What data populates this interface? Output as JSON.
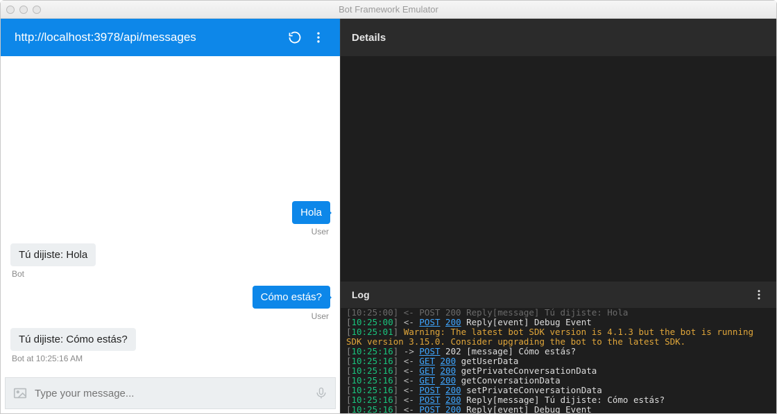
{
  "window": {
    "title": "Bot Framework Emulator"
  },
  "toolbar": {
    "url": "http://localhost:3978/api/messages"
  },
  "chat": {
    "messages": [
      {
        "side": "user",
        "text": "Hola",
        "sender": "User"
      },
      {
        "side": "bot",
        "text": "Tú dijiste: Hola",
        "sender": "Bot"
      },
      {
        "side": "user",
        "text": "Cómo estás?",
        "sender": "User"
      },
      {
        "side": "bot",
        "text": "Tú dijiste: Cómo estás?",
        "sender": "Bot at 10:25:16 AM"
      }
    ],
    "composer_placeholder": "Type your message..."
  },
  "panels": {
    "details": "Details",
    "log": "Log"
  },
  "log": [
    {
      "ts": "10:25:00",
      "dir": "<-",
      "method": "POST",
      "status": "200",
      "rest": "Reply[message] Tú dijiste: Hola",
      "clipped": true
    },
    {
      "ts": "10:25:00",
      "dir": "<-",
      "method": "POST",
      "status": "200",
      "rest": "Reply[event] Debug Event"
    },
    {
      "ts": "10:25:01",
      "warn": "Warning: The latest bot SDK version is 4.1.3 but the bot is running SDK version 3.15.0. Consider upgrading the bot to the latest SDK."
    },
    {
      "ts": "10:25:16",
      "dir": "->",
      "method": "POST",
      "status_plain": "202",
      "rest": "[message] Cómo estás?"
    },
    {
      "ts": "10:25:16",
      "dir": "<-",
      "method": "GET",
      "status": "200",
      "rest": "getUserData"
    },
    {
      "ts": "10:25:16",
      "dir": "<-",
      "method": "GET",
      "status": "200",
      "rest": "getPrivateConversationData"
    },
    {
      "ts": "10:25:16",
      "dir": "<-",
      "method": "GET",
      "status": "200",
      "rest": "getConversationData"
    },
    {
      "ts": "10:25:16",
      "dir": "<-",
      "method": "POST",
      "status": "200",
      "rest": "setPrivateConversationData"
    },
    {
      "ts": "10:25:16",
      "dir": "<-",
      "method": "POST",
      "status": "200",
      "rest": "Reply[message] Tú dijiste: Cómo estás?"
    },
    {
      "ts": "10:25:16",
      "dir": "<-",
      "method": "POST",
      "status": "200",
      "rest": "Reply[event] Debug Event"
    }
  ]
}
